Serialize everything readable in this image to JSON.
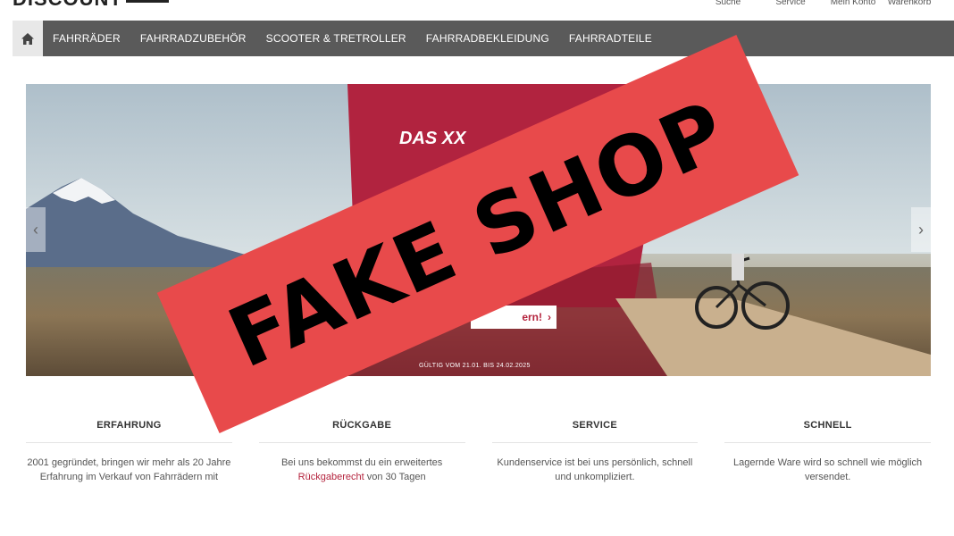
{
  "header": {
    "logo_text": "DISCOUNT",
    "links": [
      {
        "label": "Suche"
      },
      {
        "label": "Service"
      },
      {
        "label": "Mein Konto"
      },
      {
        "label": "Warenkorb"
      }
    ]
  },
  "nav": {
    "home_icon": "home-icon",
    "items": [
      {
        "label": "FAHRRÄDER"
      },
      {
        "label": "FAHRRADZUBEHÖR"
      },
      {
        "label": "SCOOTER & TRETROLLER"
      },
      {
        "label": "FAHRRADBEKLEIDUNG"
      },
      {
        "label": "FAHRRADTEILE"
      }
    ]
  },
  "hero": {
    "promo_title": "DAS XX",
    "cta_label": "ern!",
    "valid_text": "GÜLTIG VOM 21.01. BIS 24.02.2025",
    "prev_icon": "chevron-left-icon",
    "next_icon": "chevron-right-icon"
  },
  "stamp": {
    "text": "FAKE SHOP",
    "color": "#e84a4b"
  },
  "features": [
    {
      "title": "ERFAHRUNG",
      "text": "2001 gegründet, bringen wir mehr als 20 Jahre Erfahrung im Verkauf von Fahrrädern mit",
      "link": "",
      "text_after": ""
    },
    {
      "title": "RÜCKGABE",
      "text": "Bei uns bekommst du ein erweitertes ",
      "link": "Rückgaberecht",
      "text_after": " von 30 Tagen"
    },
    {
      "title": "SERVICE",
      "text": "Kundenservice ist bei uns persönlich, schnell und unkompliziert.",
      "link": "",
      "text_after": ""
    },
    {
      "title": "SCHNELL",
      "text": "Lagernde Ware wird so schnell wie möglich versendet.",
      "link": "",
      "text_after": ""
    }
  ],
  "colors": {
    "nav_bg": "#5a5a5a",
    "accent": "#b4233d"
  }
}
